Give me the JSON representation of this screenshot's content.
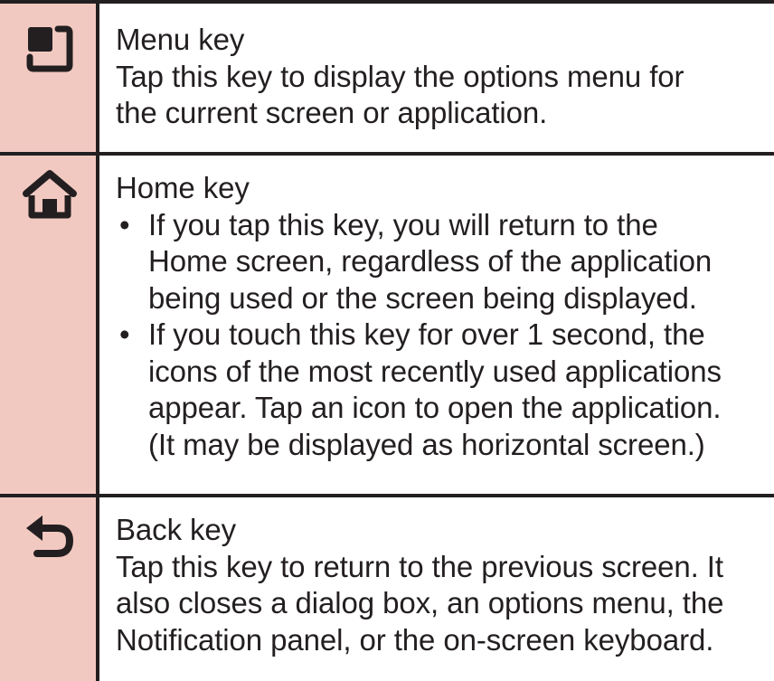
{
  "colors": {
    "icon_column_bg": "#f2c9c1",
    "rule": "#231f20",
    "text": "#231f20"
  },
  "keys": [
    {
      "icon": "menu-key-icon",
      "title": "Menu key",
      "lines": [
        "Tap this key to display the options menu for",
        "the current screen or application."
      ]
    },
    {
      "icon": "home-key-icon",
      "title": "Home key",
      "bullets": [
        {
          "lines": [
            "If you tap this key, you will return to the",
            "Home screen, regardless of the application",
            "being used or the screen being displayed."
          ]
        },
        {
          "lines": [
            "If you touch this key for over 1 second, the",
            "icons of the most recently used applications",
            "appear. Tap an icon to open the application.",
            "(It may be displayed as horizontal screen.)"
          ]
        }
      ],
      "bullet_symbol": "•"
    },
    {
      "icon": "back-key-icon",
      "title": "Back key",
      "lines": [
        "Tap this key to return to the previous screen. It",
        "also closes a dialog box, an options menu, the",
        "Notification panel, or the on-screen keyboard."
      ]
    }
  ]
}
